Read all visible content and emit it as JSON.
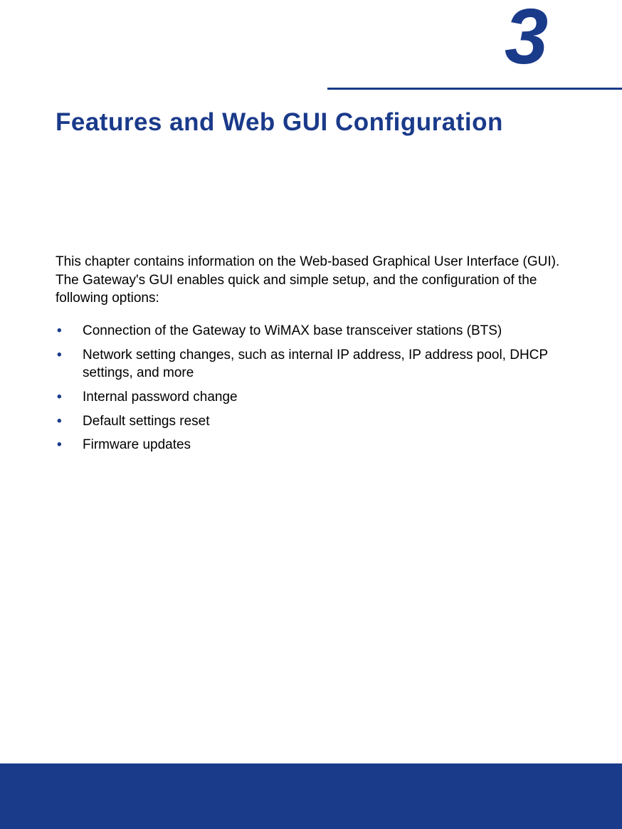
{
  "chapter": {
    "number": "3",
    "title": "Features and Web GUI Configuration"
  },
  "intro": "This chapter contains information on the Web-based Graphical User Interface (GUI). The Gateway's GUI enables quick and simple setup, and the configura­tion of the following options:",
  "bullets": [
    "Connection of the Gateway to WiMAX base transceiver stations (BTS)",
    "Network setting changes, such as internal IP address, IP address pool, DHCP settings, and more",
    "Internal password change",
    "Default settings reset",
    "Firmware updates"
  ]
}
